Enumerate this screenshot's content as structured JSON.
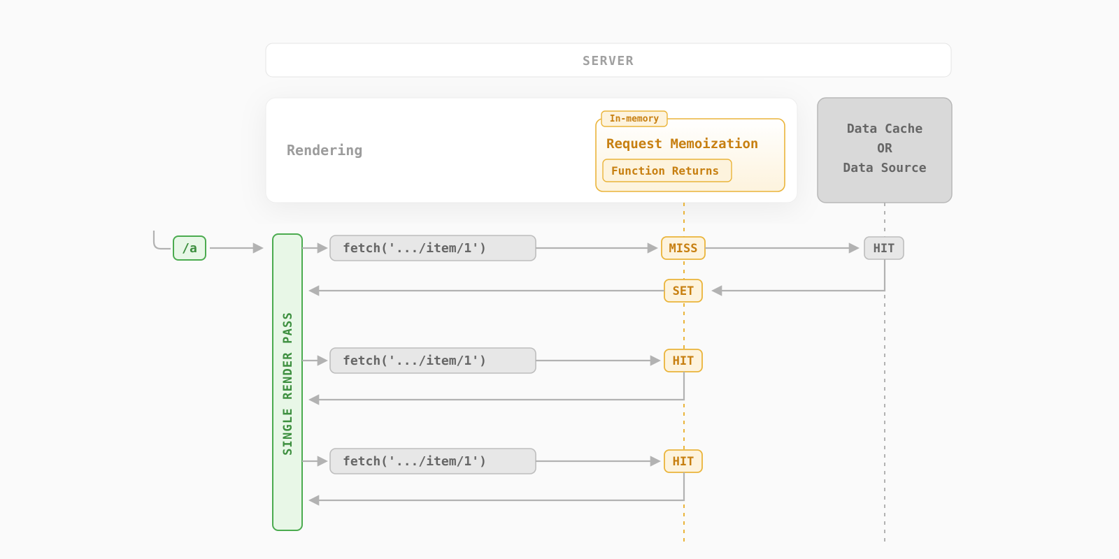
{
  "header": {
    "server": "SERVER"
  },
  "rendering": {
    "label": "Rendering",
    "memo_tag": "In-memory",
    "memo_title": "Request Memoization",
    "memo_sub": "Function Returns"
  },
  "datacache": {
    "line1": "Data Cache",
    "line2": "OR",
    "line3": "Data Source"
  },
  "route": "/a",
  "pass_label": "SINGLE RENDER PASS",
  "fetch_label": "fetch('.../item/1')",
  "status": {
    "miss": "MISS",
    "hit": "HIT",
    "set": "SET"
  }
}
